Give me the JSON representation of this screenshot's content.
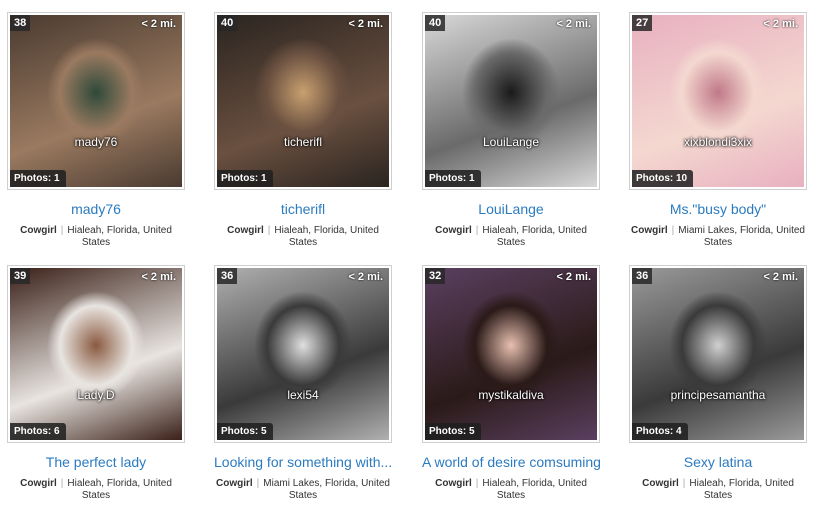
{
  "cards": [
    {
      "age": "38",
      "distance": "< 2 mi.",
      "username": "mady76",
      "photos": "Photos: 1",
      "headline": "mady76",
      "type": "Cowgirl",
      "location": "Hialeah, Florida, United States",
      "palette": [
        "#4a3a30",
        "#9a7a60",
        "#2e4a3a"
      ]
    },
    {
      "age": "40",
      "distance": "< 2 mi.",
      "username": "ticherifl",
      "photos": "Photos: 1",
      "headline": "ticherifl",
      "type": "Cowgirl",
      "location": "Hialeah, Florida, United States",
      "palette": [
        "#2a2420",
        "#6a5040",
        "#c8a070"
      ]
    },
    {
      "age": "40",
      "distance": "< 2 mi.",
      "username": "LouiLange",
      "photos": "Photos: 1",
      "headline": "LouiLange",
      "type": "Cowgirl",
      "location": "Hialeah, Florida, United States",
      "palette": [
        "#d8d8d8",
        "#6a6a6a",
        "#1a1a1a"
      ]
    },
    {
      "age": "27",
      "distance": "< 2 mi.",
      "username": "xixblondi3xix",
      "photos": "Photos: 10",
      "headline": "Ms.\"busy body\"",
      "type": "Cowgirl",
      "location": "Miami Lakes, Florida, United States",
      "palette": [
        "#e8b0c0",
        "#f4d8d0",
        "#c07888"
      ]
    },
    {
      "age": "39",
      "distance": "< 2 mi.",
      "username": "Lady.D",
      "photos": "Photos: 6",
      "headline": "The perfect lady",
      "type": "Cowgirl",
      "location": "Hialeah, Florida, United States",
      "palette": [
        "#3a2018",
        "#e8e4e0",
        "#8a5a40"
      ]
    },
    {
      "age": "36",
      "distance": "< 2 mi.",
      "username": "lexi54",
      "photos": "Photos: 5",
      "headline": "Looking for something with...",
      "type": "Cowgirl",
      "location": "Miami Lakes, Florida, United States",
      "palette": [
        "#b0b0b0",
        "#3a3a3a",
        "#e0e0e0"
      ]
    },
    {
      "age": "32",
      "distance": "< 2 mi.",
      "username": "mystikaldiva",
      "photos": "Photos: 5",
      "headline": "A world of desire comsuming...",
      "type": "Cowgirl",
      "location": "Hialeah, Florida, United States",
      "palette": [
        "#5a4060",
        "#2a1a18",
        "#e8c0b0"
      ]
    },
    {
      "age": "36",
      "distance": "< 2 mi.",
      "username": "principesamantha",
      "photos": "Photos: 4",
      "headline": "Sexy latina",
      "type": "Cowgirl",
      "location": "Hialeah, Florida, United States",
      "palette": [
        "#9a9a9a",
        "#3a3a3a",
        "#d0d0d0"
      ]
    }
  ]
}
